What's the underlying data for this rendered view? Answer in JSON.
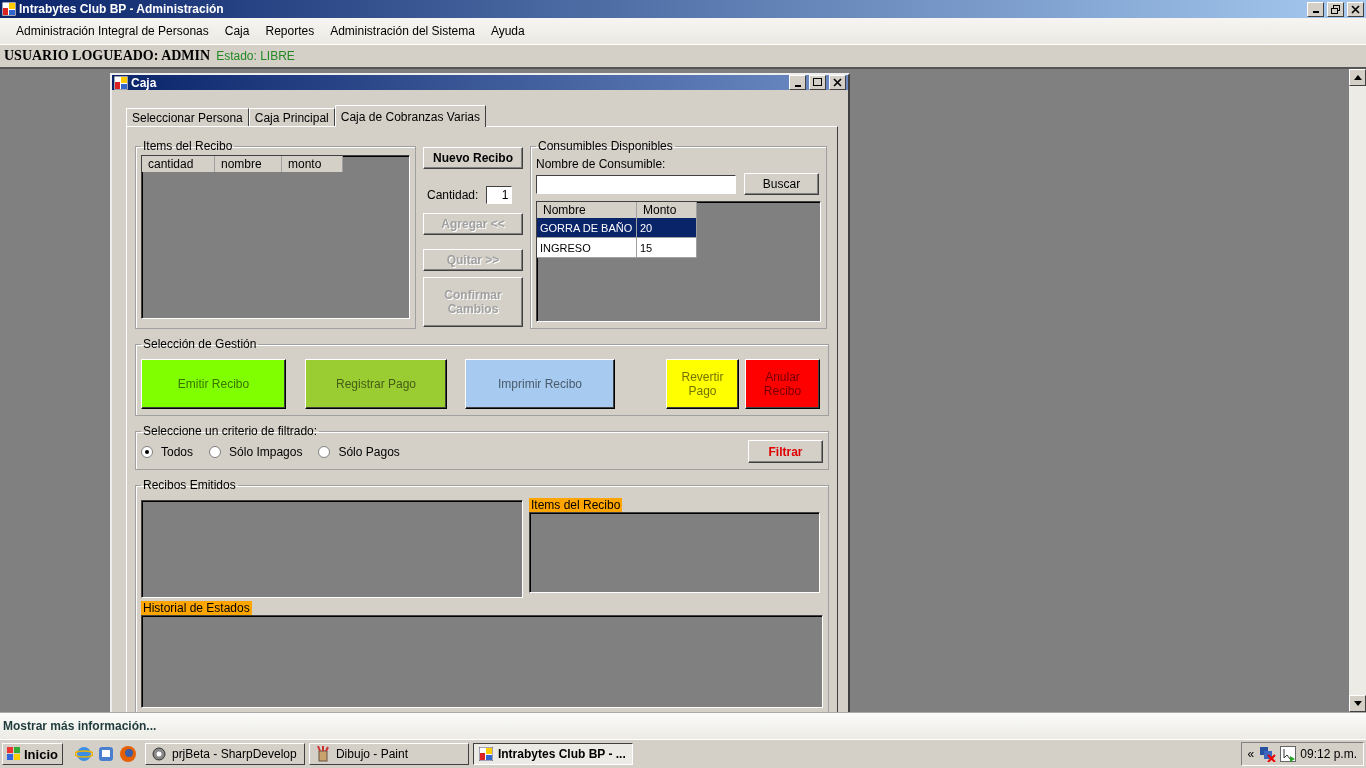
{
  "app_window": {
    "title": "Intrabytes Club BP - Administración"
  },
  "menu": [
    "Administración Integral de Personas",
    "Caja",
    "Reportes",
    "Administración del Sistema",
    "Ayuda"
  ],
  "user_bar": {
    "user": "USUARIO LOGUEADO: ADMIN",
    "status": "Estado: LIBRE"
  },
  "child_window": {
    "title": "Caja",
    "tabs": [
      {
        "label": "Seleccionar Persona",
        "selected": false
      },
      {
        "label": "Caja Principal",
        "selected": false
      },
      {
        "label": "Caja de Cobranzas Varias",
        "selected": true
      }
    ],
    "items_group": {
      "title": "Items del Recibo",
      "columns": [
        "cantidad",
        "nombre",
        "monto"
      ]
    },
    "new_button": "Nuevo Recibo",
    "quantity": {
      "label": "Cantidad:",
      "value": "1"
    },
    "actions": [
      {
        "label": "Agregar <<",
        "disabled": true
      },
      {
        "label": "Quitar >>",
        "disabled": true
      },
      {
        "label": "Confirmar Cambios",
        "disabled": true
      }
    ],
    "consumables": {
      "title": "Consumibles Disponibles",
      "field_label": "Nombre de Consumible:",
      "search_button": "Buscar",
      "columns": [
        "Nombre",
        "Monto"
      ],
      "rows": [
        {
          "cells": [
            "GORRA DE BAÑO",
            "20"
          ],
          "selected": true
        },
        {
          "cells": [
            "INGRESO",
            "15"
          ],
          "selected": false
        }
      ]
    },
    "gestion": {
      "title": "Selección de Gestión",
      "buttons": [
        {
          "label": "Emitir Recibo",
          "color": "#80ff00"
        },
        {
          "label": "Registrar Pago",
          "color": "#9acd32"
        },
        {
          "label": "Imprimir Recibo",
          "color": "#a6caf0"
        },
        {
          "label": "Revertir Pago",
          "color": "#ffff00"
        },
        {
          "label": "Anular Recibo",
          "color": "#ff0000"
        }
      ]
    },
    "filter": {
      "title": "Seleccione un criterio de filtrado:",
      "options": [
        {
          "label": "Todos",
          "selected": true
        },
        {
          "label": "Sólo Impagos",
          "selected": false
        },
        {
          "label": "Sólo Pagos",
          "selected": false
        }
      ],
      "button": "Filtrar"
    },
    "receipts": {
      "title": "Recibos Emitidos",
      "items_label": "Items del Recibo",
      "history_label": "Historial de Estados"
    }
  },
  "status_bar": "Mostrar más información...",
  "taskbar": {
    "start": "Inicio",
    "tasks": [
      {
        "label": "prjBeta - SharpDevelop",
        "selected": false
      },
      {
        "label": "Dibujo - Paint",
        "selected": false
      },
      {
        "label": "Intrabytes Club BP - ...",
        "selected": true
      }
    ],
    "tray_expand": "«",
    "clock": "09:12 p.m."
  }
}
